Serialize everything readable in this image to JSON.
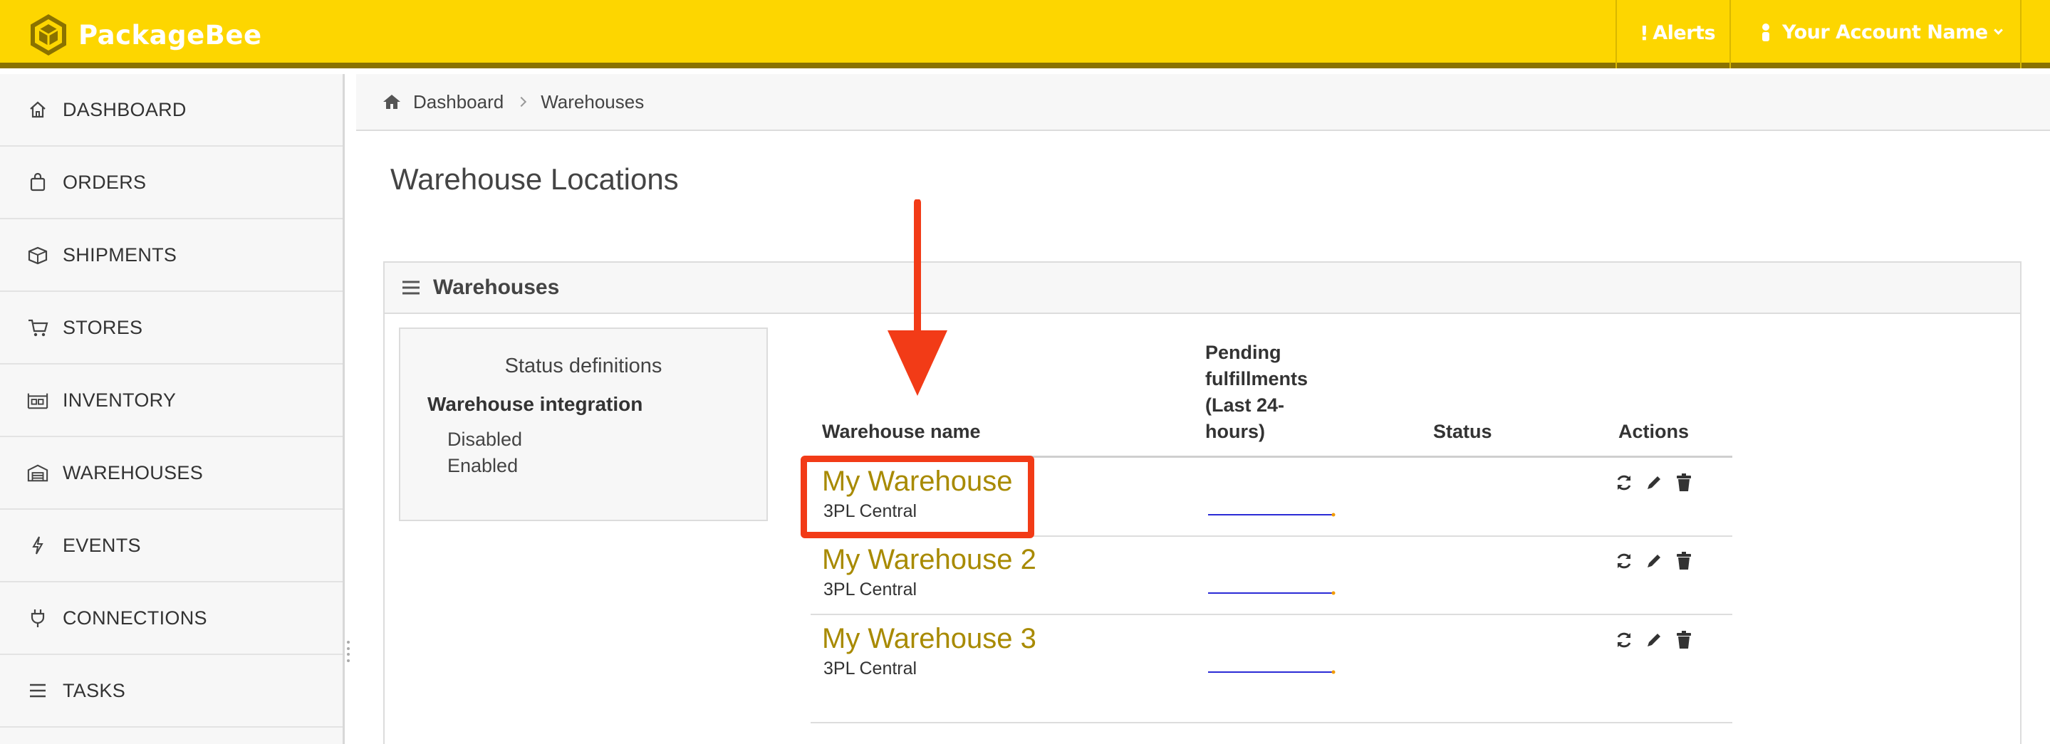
{
  "header": {
    "brand": "PackageBee",
    "alerts_label": "Alerts",
    "alerts_glyph": "!",
    "account_label": "Your Account Name",
    "bg_color": "#fdd600",
    "accent_color": "#8a7200"
  },
  "sidebar": {
    "items": [
      {
        "label": "DASHBOARD",
        "icon": "home-icon"
      },
      {
        "label": "ORDERS",
        "icon": "shopping-bag-icon"
      },
      {
        "label": "SHIPMENTS",
        "icon": "package-icon"
      },
      {
        "label": "STORES",
        "icon": "cart-icon"
      },
      {
        "label": "INVENTORY",
        "icon": "warehouse-shelf-icon"
      },
      {
        "label": "WAREHOUSES",
        "icon": "warehouse-icon"
      },
      {
        "label": "EVENTS",
        "icon": "lightning-icon"
      },
      {
        "label": "CONNECTIONS",
        "icon": "plug-icon"
      },
      {
        "label": "TASKS",
        "icon": "list-icon"
      }
    ]
  },
  "breadcrumb": {
    "items": [
      "Dashboard",
      "Warehouses"
    ]
  },
  "page": {
    "title": "Warehouse Locations"
  },
  "panel": {
    "title": "Warehouses",
    "status_definitions": {
      "title": "Status definitions",
      "subtitle": "Warehouse integration",
      "items": [
        "Disabled",
        "Enabled"
      ]
    },
    "table": {
      "columns": {
        "name": "Warehouse name",
        "pending": [
          "Pending",
          "fulfillments",
          "(Last 24-",
          "hours)"
        ],
        "status": "Status",
        "actions": "Actions"
      },
      "rows": [
        {
          "name": "My Warehouse",
          "provider": "3PL Central",
          "status": ""
        },
        {
          "name": "My Warehouse 2",
          "provider": "3PL Central",
          "status": ""
        },
        {
          "name": "My Warehouse 3",
          "provider": "3PL Central",
          "status": ""
        }
      ]
    }
  },
  "annotation": {
    "highlight_color": "#f23b17",
    "highlighted_row": 0
  }
}
